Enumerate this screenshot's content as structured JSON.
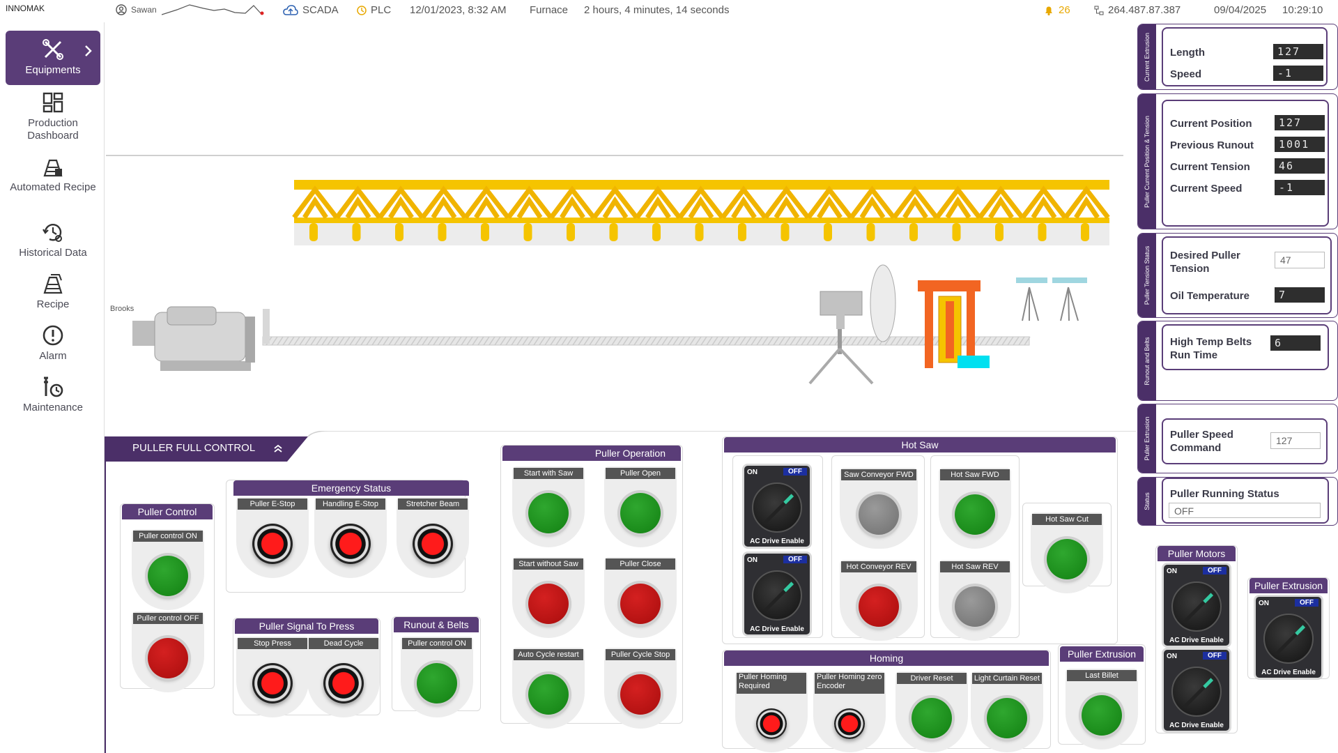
{
  "topbar": {
    "brand": "INNOMAK",
    "user": "Sawan",
    "scada": "SCADA",
    "plc": "PLC",
    "datetime": "12/01/2023, 8:32 AM",
    "furnace": "Furnace",
    "duration": "2 hours, 4 minutes, 14 seconds",
    "alerts": "26",
    "ip": "264.487.87.387",
    "date": "09/04/2025",
    "time": "10:29:10"
  },
  "sidebar": {
    "items": [
      {
        "label": "Equipments",
        "icon": "tools-icon",
        "active": true
      },
      {
        "label": "Production Dashboard",
        "icon": "dashboard-icon"
      },
      {
        "label": "Automated Recipe",
        "icon": "automated-recipe-icon"
      },
      {
        "label": "Historical Data",
        "icon": "history-icon"
      },
      {
        "label": "Recipe",
        "icon": "recipe-icon"
      },
      {
        "label": "Alarm",
        "icon": "alarm-icon"
      },
      {
        "label": "Maintenance",
        "icon": "maintenance-icon"
      }
    ]
  },
  "process": {
    "label_small": "Brooks"
  },
  "right_panel": {
    "current_extrusion": {
      "tab": "Current Extrusion",
      "length_label": "Length",
      "length_value": "127",
      "speed_label": "Speed",
      "speed_value": "-1"
    },
    "puller_position": {
      "tab": "Puller Current Position & Tension",
      "current_position_label": "Current Position",
      "current_position_value": "127",
      "previous_runout_label": "Previous Runout",
      "previous_runout_value": "1001",
      "current_tension_label": "Current Tension",
      "current_tension_value": "46",
      "current_speed_label": "Current Speed",
      "current_speed_value": "-1"
    },
    "puller_tension": {
      "tab": "Puller Tension Status",
      "desired_label": "Desired Puller Tension",
      "desired_value": "47",
      "oil_label": "Oil Temperature",
      "oil_value": "7"
    },
    "runout_belts": {
      "tab": "Runout and Belts",
      "belts_label": "High Temp Belts Run Time",
      "belts_value": "6"
    },
    "puller_extrusion": {
      "tab": "Puller Extrusion",
      "speed_cmd_label": "Puller Speed Command",
      "speed_cmd_value": "127"
    },
    "status": {
      "tab": "Status",
      "running_label": "Puller Running Status",
      "running_value": "OFF"
    }
  },
  "control": {
    "header": "PULLER FULL CONTROL",
    "puller_control": {
      "title": "Puller Control",
      "on": "Puller control ON",
      "off": "Puller control OFF"
    },
    "emergency": {
      "title": "Emergency Status",
      "b1": "Puller E-Stop",
      "b2": "Handling E-Stop",
      "b3": "Stretcher Beam"
    },
    "signal_press": {
      "title": "Puller Signal To Press",
      "b1": "Stop Press",
      "b2": "Dead Cycle"
    },
    "runout": {
      "title": "Runout & Belts",
      "b1": "Puller control ON"
    },
    "operation": {
      "title": "Puller Operation",
      "b1": "Start with Saw",
      "b2": "Puller Open",
      "b3": "Start without Saw",
      "b4": "Puller Close",
      "b5": "Auto Cycle restart",
      "b6": "Puller Cycle Stop"
    },
    "hot_saw": {
      "title": "Hot Saw",
      "sel_on": "ON",
      "sel_off": "OFF",
      "sel_label": "AC Drive Enable",
      "b1": "Saw Conveyor FWD",
      "b2": "Hot Conveyor REV",
      "b3": "Hot Saw FWD",
      "b4": "Hot Saw REV",
      "b5": "Hot Saw Cut"
    },
    "homing": {
      "title": "Homing",
      "b1": "Puller Homing Required",
      "b2": "Puller Homing zero Encoder",
      "b3": "Driver Reset",
      "b4": "Light Curtain Reset"
    },
    "puller_extrusion": {
      "title": "Puller Extrusion",
      "b1": "Last Billet"
    },
    "puller_motors": {
      "title": "Puller Motors"
    },
    "puller_extrusion2": {
      "title": "Puller Extrusion"
    }
  }
}
